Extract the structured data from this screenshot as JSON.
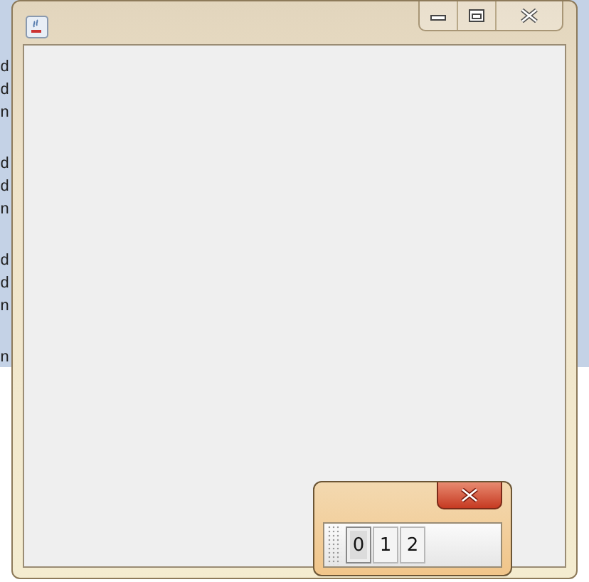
{
  "editor": {
    "blocks": [
      {
        "lines": [
          "d",
          "d",
          "n"
        ]
      },
      {
        "lines": [
          "d",
          "d",
          "n"
        ]
      },
      {
        "lines": [
          "d",
          "d",
          "n"
        ]
      },
      {
        "lines": [
          "n"
        ]
      }
    ]
  },
  "toolbar_window": {
    "buttons": [
      {
        "label": "0",
        "selected": true
      },
      {
        "label": "1",
        "selected": false
      },
      {
        "label": "2",
        "selected": false
      }
    ]
  }
}
